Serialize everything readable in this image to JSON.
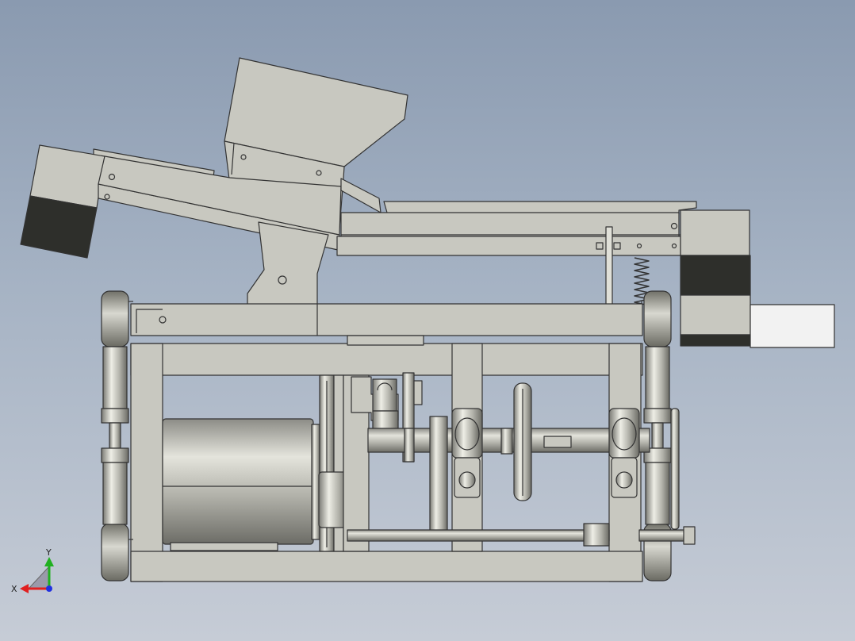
{
  "viewport": {
    "colors": {
      "background_top": "#8a9ab0",
      "background_bottom": "#c6ccd6",
      "part_face": "#c8c8c0",
      "part_edge": "#333333",
      "dark_block": "#2e2f2b",
      "white_block": "#f2f2f2"
    },
    "triad": {
      "x_label": "X",
      "y_label": "Y",
      "x_color": "#e02020",
      "y_color": "#20b020",
      "z_color": "#2030e0"
    }
  }
}
